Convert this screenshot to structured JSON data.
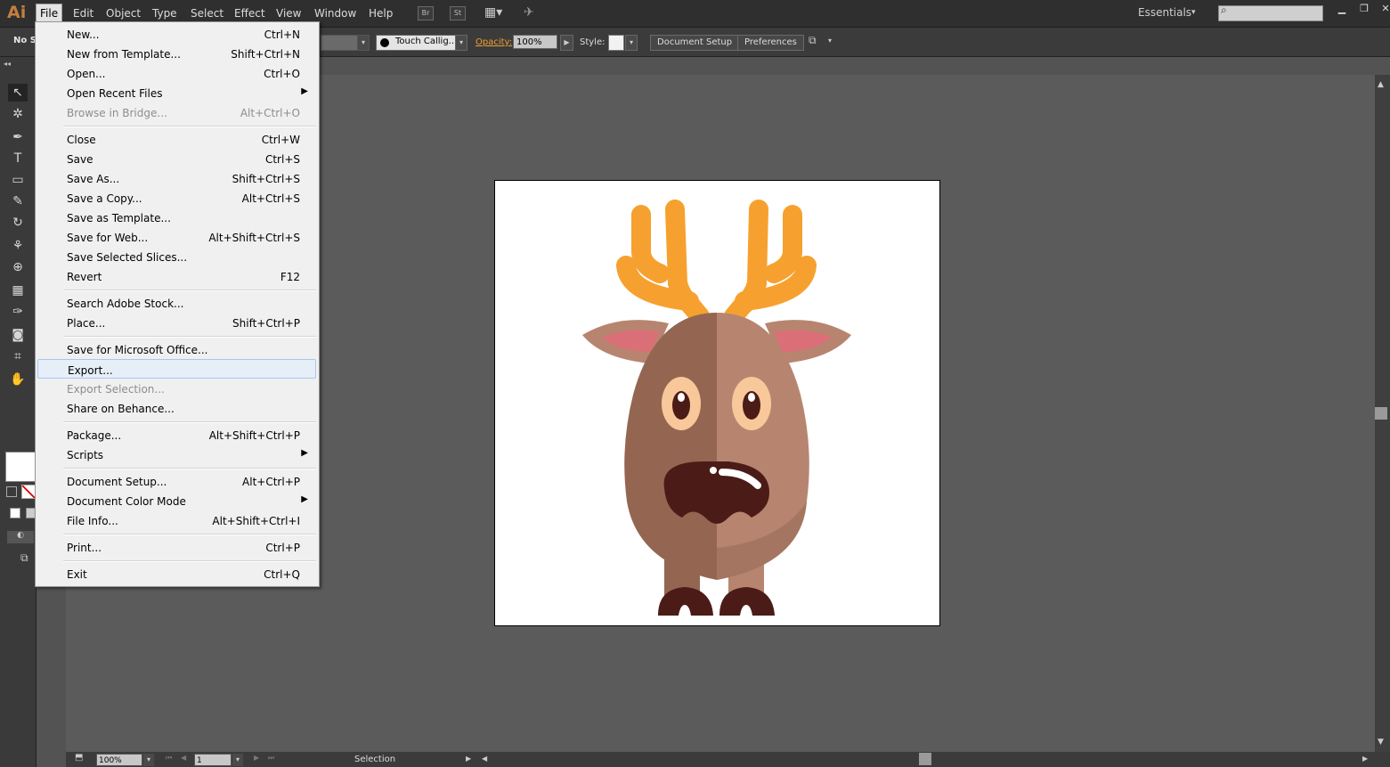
{
  "app": {
    "logo_text": "Ai"
  },
  "menubar": {
    "items": [
      "File",
      "Edit",
      "Object",
      "Type",
      "Select",
      "Effect",
      "View",
      "Window",
      "Help"
    ],
    "bridge_icon": "Br",
    "stock_icon": "St",
    "workspace": "Essentials",
    "search_placeholder": ""
  },
  "controlbar": {
    "selection": "No Se",
    "brush": "Touch Callig...",
    "opacity_label": "Opacity:",
    "opacity_value": "100%",
    "style_label": "Style:",
    "document_setup": "Document Setup",
    "preferences": "Preferences"
  },
  "file_menu": {
    "items": [
      {
        "label": "New...",
        "shortcut": "Ctrl+N"
      },
      {
        "label": "New from Template...",
        "shortcut": "Shift+Ctrl+N"
      },
      {
        "label": "Open...",
        "shortcut": "Ctrl+O"
      },
      {
        "label": "Open Recent Files",
        "shortcut": ""
      },
      {
        "label": "Browse in Bridge...",
        "shortcut": "Alt+Ctrl+O"
      },
      {
        "label": "Close",
        "shortcut": "Ctrl+W"
      },
      {
        "label": "Save",
        "shortcut": "Ctrl+S"
      },
      {
        "label": "Save As...",
        "shortcut": "Shift+Ctrl+S"
      },
      {
        "label": "Save a Copy...",
        "shortcut": "Alt+Ctrl+S"
      },
      {
        "label": "Save as Template...",
        "shortcut": ""
      },
      {
        "label": "Save for Web...",
        "shortcut": "Alt+Shift+Ctrl+S"
      },
      {
        "label": "Save Selected Slices...",
        "shortcut": ""
      },
      {
        "label": "Revert",
        "shortcut": "F12"
      },
      {
        "label": "Search Adobe Stock...",
        "shortcut": ""
      },
      {
        "label": "Place...",
        "shortcut": "Shift+Ctrl+P"
      },
      {
        "label": "Save for Microsoft Office...",
        "shortcut": ""
      },
      {
        "label": "Export...",
        "shortcut": ""
      },
      {
        "label": "Export Selection...",
        "shortcut": ""
      },
      {
        "label": "Share on Behance...",
        "shortcut": ""
      },
      {
        "label": "Package...",
        "shortcut": "Alt+Shift+Ctrl+P"
      },
      {
        "label": "Scripts",
        "shortcut": ""
      },
      {
        "label": "Document Setup...",
        "shortcut": "Alt+Ctrl+P"
      },
      {
        "label": "Document Color Mode",
        "shortcut": ""
      },
      {
        "label": "File Info...",
        "shortcut": "Alt+Shift+Ctrl+I"
      },
      {
        "label": "Print...",
        "shortcut": "Ctrl+P"
      },
      {
        "label": "Exit",
        "shortcut": "Ctrl+Q"
      }
    ]
  },
  "statusbar": {
    "zoom": "100%",
    "page": "1",
    "status": "Selection"
  },
  "colors": {
    "accent_orange": "#f0a030",
    "antler": "#f6a12f",
    "body_left": "#946652",
    "body_right": "#b7856f",
    "ear_inner": "#da6f78",
    "eye": "#f9c89a",
    "pupil": "#4b1c17",
    "mouth": "#4b1c17"
  }
}
